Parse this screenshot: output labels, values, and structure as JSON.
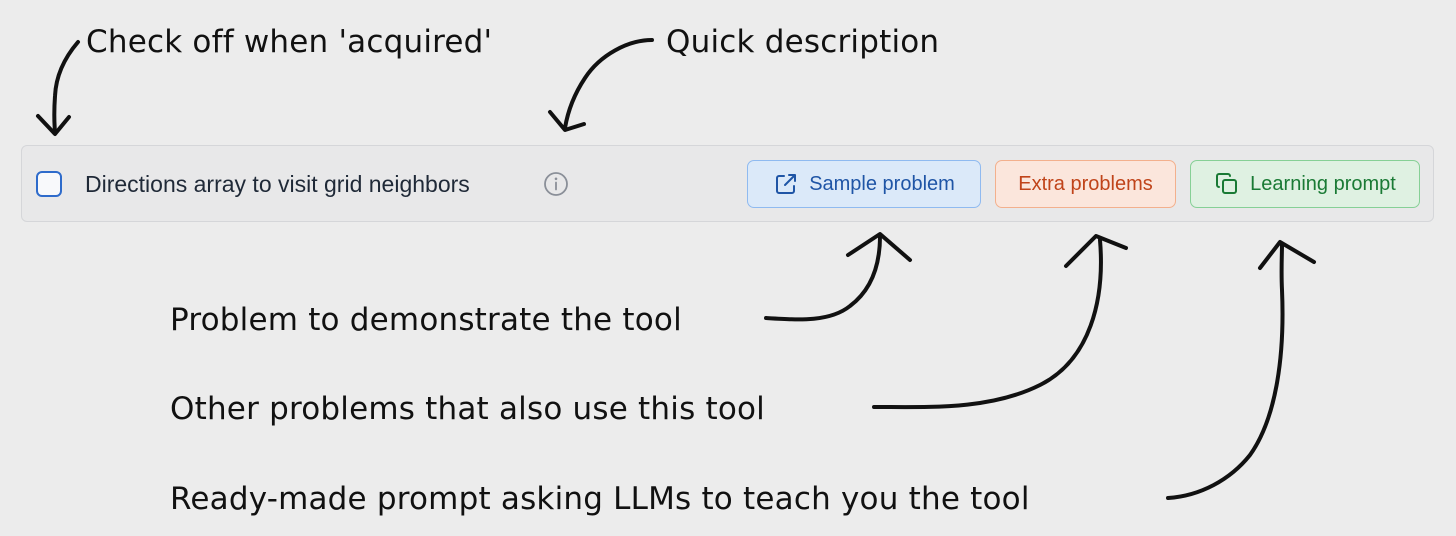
{
  "annotations": {
    "checkoff": "Check off when 'acquired'",
    "description": "Quick description",
    "sample": "Problem to demonstrate the tool",
    "extra": "Other problems that also use this tool",
    "prompt": "Ready-made prompt asking LLMs to teach you the tool"
  },
  "item": {
    "title": "Directions array to visit grid neighbors",
    "checked": false
  },
  "buttons": {
    "sample": "Sample problem",
    "extra": "Extra problems",
    "learning": "Learning prompt"
  },
  "icons": {
    "info": "info-icon",
    "sample": "external-link-icon",
    "learning": "copy-icon"
  },
  "colors": {
    "background": "#ececec",
    "checkbox_border": "#2e6bcb",
    "sample_blue": "#1f55a6",
    "extra_orange": "#c0441a",
    "learning_green": "#1a7a35"
  }
}
